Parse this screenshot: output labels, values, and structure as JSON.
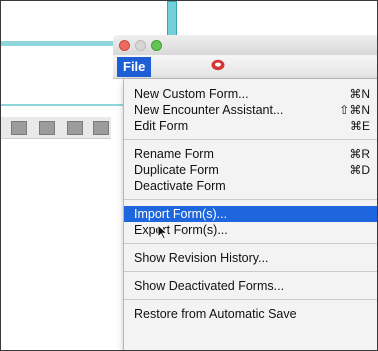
{
  "window": {
    "menubar": {
      "file_label": "File"
    }
  },
  "file_menu": {
    "groups": [
      [
        {
          "label": "New Custom Form...",
          "shortcut": "⌘N"
        },
        {
          "label": "New Encounter Assistant...",
          "shortcut": "⇧⌘N"
        },
        {
          "label": "Edit Form",
          "shortcut": "⌘E"
        }
      ],
      [
        {
          "label": "Rename Form",
          "shortcut": "⌘R"
        },
        {
          "label": "Duplicate Form",
          "shortcut": "⌘D"
        },
        {
          "label": "Deactivate Form",
          "shortcut": ""
        }
      ],
      [
        {
          "label": "Import Form(s)...",
          "shortcut": "",
          "highlighted": true
        },
        {
          "label": "Export Form(s)...",
          "shortcut": ""
        }
      ],
      [
        {
          "label": "Show Revision History...",
          "shortcut": ""
        }
      ],
      [
        {
          "label": "Show Deactivated Forms...",
          "shortcut": ""
        }
      ],
      [
        {
          "label": "Restore from Automatic Save",
          "shortcut": ""
        }
      ]
    ]
  },
  "colors": {
    "highlight": "#1d66dd",
    "accent_teal": "#8fd6dc",
    "menu_bg": "#f3f3f3"
  },
  "icons": {
    "menubar_icon": "record-icon",
    "cursor": "pointer-cursor-icon"
  }
}
